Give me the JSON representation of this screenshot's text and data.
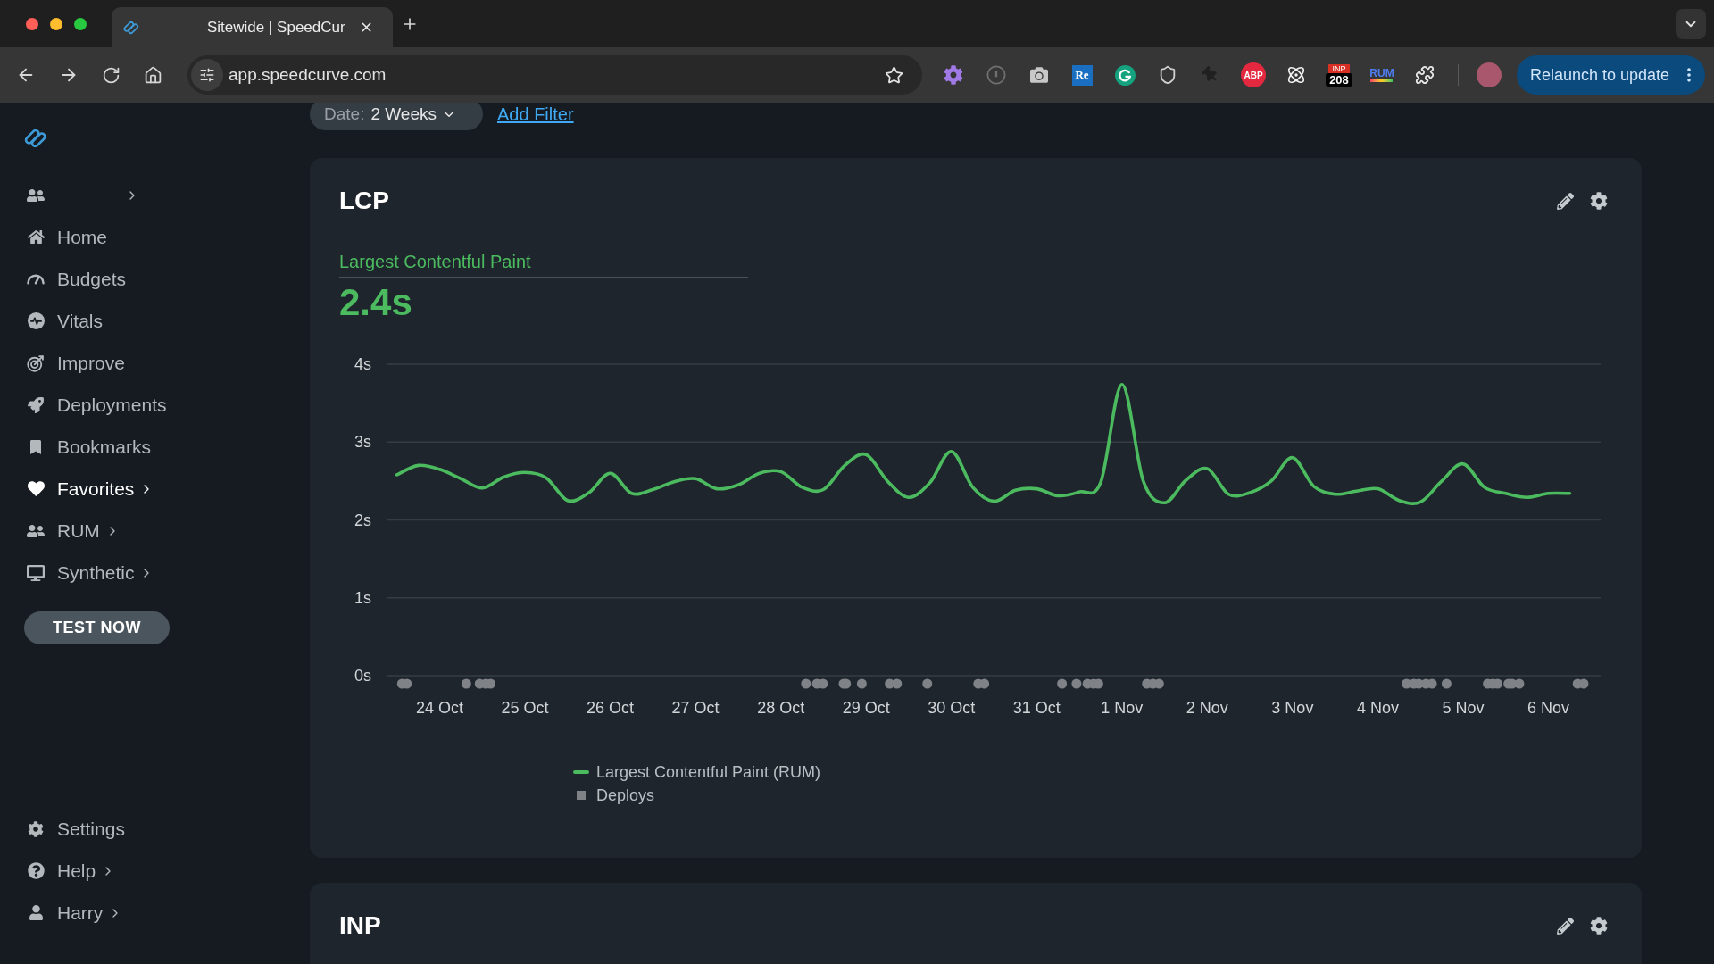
{
  "browser": {
    "tabs": [
      {
        "title": "Sitewide | SpeedCur",
        "selected": true
      }
    ],
    "address": "app.speedcurve.com",
    "extensions": [
      {
        "label": "Re"
      },
      {
        "label": "ABP"
      },
      {
        "label": "INP",
        "badge": "208"
      },
      {
        "label": "RUM"
      }
    ],
    "relaunch_button": "Relaunch to update"
  },
  "sidebar": {
    "items": [
      {
        "kind": "menu",
        "selected": false
      },
      {
        "label": "Home",
        "kind": "link",
        "selected": false
      },
      {
        "label": "Budgets",
        "kind": "link",
        "selected": false
      },
      {
        "label": "Vitals",
        "kind": "link",
        "selected": false
      },
      {
        "label": "Improve",
        "kind": "link",
        "selected": false
      },
      {
        "label": "Deployments",
        "kind": "link",
        "selected": false
      },
      {
        "label": "Bookmarks",
        "kind": "link",
        "selected": false
      },
      {
        "label": "Favorites",
        "kind": "menu",
        "selected": true
      },
      {
        "label": "RUM",
        "kind": "menu",
        "selected": false
      },
      {
        "label": "Synthetic",
        "kind": "menu",
        "selected": false
      }
    ],
    "test_button": "TEST NOW",
    "footer_items": [
      {
        "label": "Settings",
        "kind": "link",
        "selected": false
      },
      {
        "label": "Help",
        "kind": "menu",
        "selected": false
      },
      {
        "label": "Harry",
        "kind": "menu",
        "selected": false
      }
    ]
  },
  "filters": {
    "date": {
      "label": "Date:",
      "value": "2 Weeks"
    },
    "add_filter_link": "Add Filter"
  },
  "cards": [
    {
      "title": "LCP",
      "metric_label": "Largest Contentful Paint",
      "metric_value": "2.4s",
      "chart_data": {
        "type": "line",
        "grid": true,
        "categories": [
          null,
          null,
          "24 Oct",
          null,
          null,
          null,
          "25 Oct",
          null,
          null,
          null,
          "26 Oct",
          null,
          null,
          null,
          "27 Oct",
          null,
          null,
          null,
          "28 Oct",
          null,
          null,
          null,
          "29 Oct",
          null,
          null,
          null,
          "30 Oct",
          null,
          null,
          null,
          "31 Oct",
          null,
          null,
          null,
          "1 Nov",
          null,
          null,
          null,
          "2 Nov",
          null,
          null,
          null,
          "3 Nov",
          null,
          null,
          null,
          "4 Nov",
          null,
          null,
          null,
          "5 Nov",
          null,
          null,
          null,
          "6 Nov",
          null,
          null
        ],
        "series": [
          {
            "name": "Largest Contentful Paint (RUM)",
            "color": "#4cbb5f",
            "values": [
              2.58,
              2.7,
              2.65,
              2.53,
              2.41,
              2.55,
              2.61,
              2.54,
              2.25,
              2.35,
              2.6,
              2.34,
              2.39,
              2.49,
              2.53,
              2.4,
              2.45,
              2.6,
              2.62,
              2.42,
              2.39,
              2.7,
              2.84,
              2.5,
              2.29,
              2.48,
              2.88,
              2.42,
              2.24,
              2.38,
              2.4,
              2.31,
              2.36,
              2.48,
              3.74,
              2.5,
              2.22,
              2.51,
              2.66,
              2.33,
              2.35,
              2.5,
              2.8,
              2.43,
              2.33,
              2.37,
              2.4,
              2.25,
              2.23,
              2.5,
              2.72,
              2.42,
              2.34,
              2.29,
              2.34,
              2.34,
              null
            ]
          }
        ],
        "ylim": [
          0,
          4
        ],
        "yticks": [
          {
            "value": 0,
            "label": "0s"
          },
          {
            "value": 1,
            "label": "1s"
          },
          {
            "value": 2,
            "label": "2s"
          },
          {
            "value": 3,
            "label": "3s"
          },
          {
            "value": 4,
            "label": "4s"
          }
        ]
      },
      "deploys": {
        "label": "Deploys",
        "color": "#7f8387"
      }
    },
    {
      "title": "INP"
    }
  ]
}
